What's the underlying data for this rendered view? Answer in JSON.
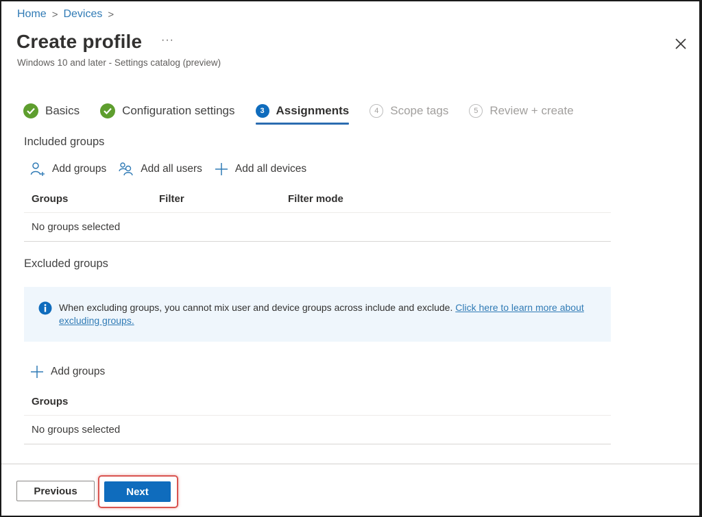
{
  "breadcrumb": [
    {
      "label": "Home"
    },
    {
      "label": "Devices"
    }
  ],
  "breadcrumb_separator": ">",
  "header": {
    "title": "Create profile",
    "more_label": "···",
    "subtitle": "Windows 10 and later - Settings catalog (preview)",
    "close_icon": "close-icon"
  },
  "wizard": {
    "steps": [
      {
        "number": "1",
        "label": "Basics",
        "state": "completed",
        "icon": "check-circle-icon"
      },
      {
        "number": "2",
        "label": "Configuration settings",
        "state": "completed",
        "icon": "check-circle-icon"
      },
      {
        "number": "3",
        "label": "Assignments",
        "state": "active"
      },
      {
        "number": "4",
        "label": "Scope tags",
        "state": "disabled"
      },
      {
        "number": "5",
        "label": "Review + create",
        "state": "disabled"
      }
    ]
  },
  "included": {
    "label": "Included groups",
    "commands": [
      {
        "label": "Add groups",
        "icon": "add-person-icon"
      },
      {
        "label": "Add all users",
        "icon": "people-icon"
      },
      {
        "label": "Add all devices",
        "icon": "plus-icon"
      }
    ],
    "columns": [
      "Groups",
      "Filter",
      "Filter mode"
    ],
    "empty_text": "No groups selected"
  },
  "excluded": {
    "label": "Excluded groups",
    "info": {
      "icon": "info-icon",
      "text": "When excluding groups, you cannot mix user and device groups across include and exclude. ",
      "link": "Click here to learn more about excluding groups."
    },
    "commands": [
      {
        "label": "Add groups",
        "icon": "plus-icon"
      }
    ],
    "columns": [
      "Groups"
    ],
    "empty_text": "No groups selected"
  },
  "footer": {
    "previous_label": "Previous",
    "next_label": "Next"
  },
  "colors": {
    "accent": "#0f6cbd",
    "link": "#2f7ab5",
    "success": "#5e9e2e",
    "info_background": "#eff6fc",
    "highlight": "#d9534f"
  }
}
